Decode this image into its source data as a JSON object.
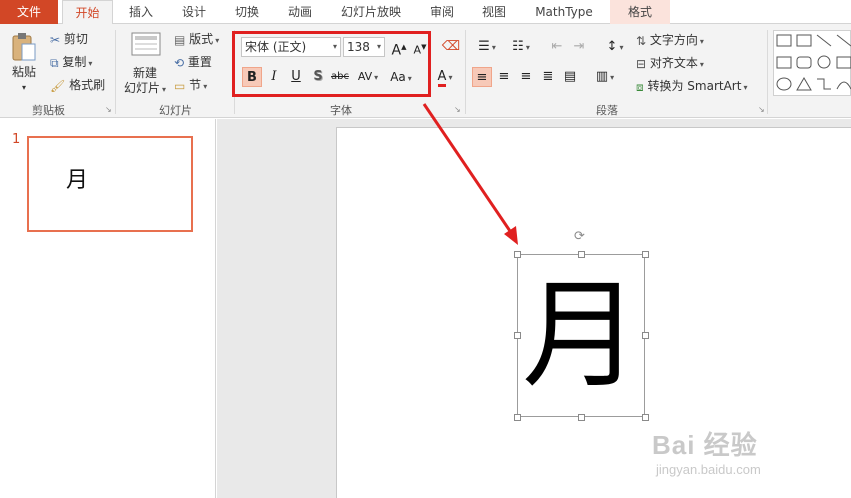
{
  "tabs": [
    {
      "label": "文件"
    },
    {
      "label": "开始"
    },
    {
      "label": "插入"
    },
    {
      "label": "设计"
    },
    {
      "label": "切换"
    },
    {
      "label": "动画"
    },
    {
      "label": "幻灯片放映"
    },
    {
      "label": "审阅"
    },
    {
      "label": "视图"
    },
    {
      "label": "MathType"
    },
    {
      "label": "格式"
    }
  ],
  "clipboard": {
    "paste": "粘贴",
    "cut": "剪切",
    "copy": "复制",
    "format_painter": "格式刷",
    "group": "剪贴板"
  },
  "slides_group": {
    "new_line1": "新建",
    "new_line2": "幻灯片",
    "layout": "版式",
    "reset": "重置",
    "section": "节",
    "group": "幻灯片"
  },
  "font": {
    "name": "宋体 (正文)",
    "size": "138",
    "grow": "A",
    "shrink": "A",
    "bold": "B",
    "italic": "I",
    "underline": "U",
    "shadow": "S",
    "strike": "abc",
    "spacing": "AV",
    "case": "Aa",
    "color": "A",
    "group": "字体",
    "highlighted": true
  },
  "paragraph": {
    "text_direction": "文字方向",
    "align_text": "对齐文本",
    "smartart": "转换为 SmartArt",
    "group": "段落"
  },
  "thumbnail": {
    "number": "1",
    "char": "月"
  },
  "slide": {
    "char": "月"
  },
  "watermark": {
    "line1": "Bai 经验",
    "line2": "jingyan.baidu.com"
  },
  "colors": {
    "accent": "#d24726",
    "highlight_box": "#e02020",
    "arrow": "#e02020"
  }
}
